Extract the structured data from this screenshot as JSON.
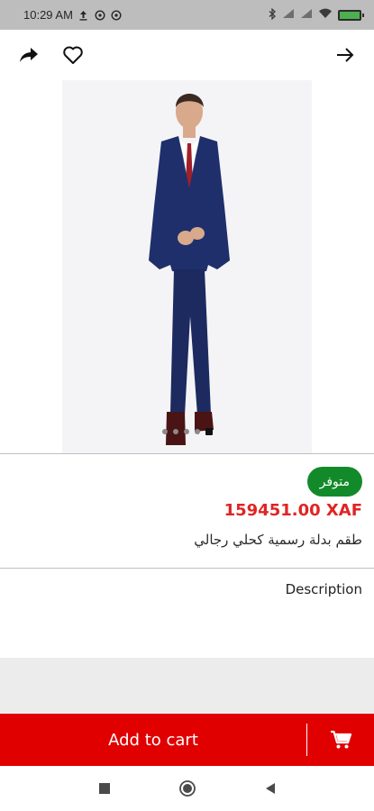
{
  "status_bar": {
    "time": "10:29 AM",
    "left_icons": [
      "upload-icon",
      "whatsapp-icon",
      "whatsapp-icon"
    ],
    "right_icons": [
      "bluetooth-icon",
      "signal-icon",
      "signal-icon",
      "wifi-icon",
      "battery-icon"
    ]
  },
  "top_bar": {
    "share_icon": "share-icon",
    "favorite_icon": "heart-outline-icon",
    "back_icon": "arrow-forward-icon"
  },
  "gallery": {
    "image_description_icon": "product-photo",
    "dot_count": 5,
    "active_dot": 4
  },
  "product": {
    "availability": "متوفر",
    "availability_color": "#138a2a",
    "price": "159451.00 XAF",
    "price_color": "#e02424",
    "title": "طقم بدلة رسمية كحلي رجالي"
  },
  "description": {
    "label": "Description"
  },
  "cart": {
    "label": "Add to cart",
    "icon": "cart-icon",
    "color": "#e00000"
  },
  "nav_bar": {
    "recents_icon": "square-icon",
    "home_icon": "circle-icon",
    "back_icon": "triangle-back-icon"
  }
}
